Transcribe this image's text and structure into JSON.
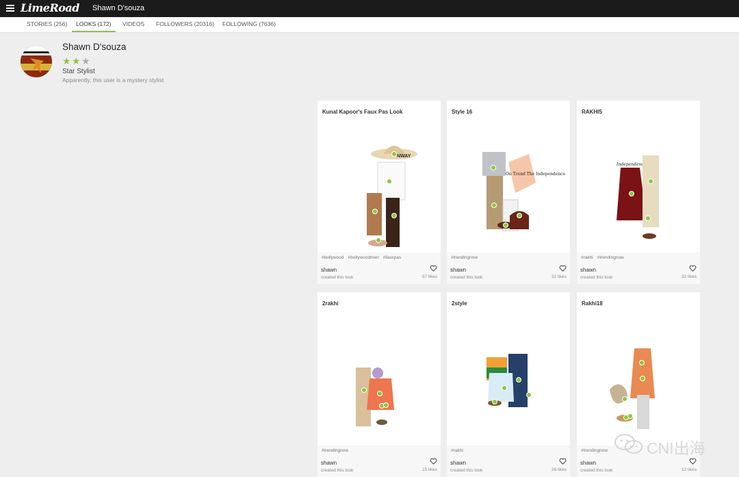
{
  "header": {
    "logo": "LimeRoad",
    "username": "Shawn D'souza"
  },
  "tabs": [
    {
      "label": "STORIES (256)"
    },
    {
      "label": "LOOKS (172)"
    },
    {
      "label": "VIDEOS"
    },
    {
      "label": "FOLLOWERS (20316)"
    },
    {
      "label": "FOLLOWING (7636)"
    }
  ],
  "profile": {
    "name": "Shawn D'souza",
    "rating": {
      "filled": 2,
      "max": 3
    },
    "rank": "Star Stylist",
    "bio": "Apparently, this user is a mystery stylist"
  },
  "cards": [
    {
      "title": "Kunal Kapoor's Faux Pas Look",
      "tags": [
        "#bollywood",
        "#bollywoodmen",
        "#fauxpas"
      ],
      "author": "shawn",
      "created": "created this look",
      "likes": "57 likes",
      "banner": "NWAY"
    },
    {
      "title": "Style 16",
      "tags": [
        "#trendingnow"
      ],
      "author": "shawn",
      "created": "created this look",
      "likes": "32 likes",
      "banner": "On Trend The Independence"
    },
    {
      "title": "RAKHI5",
      "tags": [
        "#rakhi",
        "#trendingnow"
      ],
      "author": "shawn",
      "created": "created this look",
      "likes": "32 likes",
      "banner": "Independence"
    },
    {
      "title": "2rakhi",
      "tags": [
        "#trendingnow"
      ],
      "author": "shawn",
      "created": "created this look",
      "likes": "15 likes"
    },
    {
      "title": "2style",
      "tags": [
        "#rakhi"
      ],
      "author": "shawn",
      "created": "created this look",
      "likes": "26 likes"
    },
    {
      "title": "Rakhi18",
      "tags": [
        "#trendingnow"
      ],
      "author": "shawn",
      "created": "created this look",
      "likes": "12 likes"
    }
  ],
  "watermark": {
    "text": "CNI出海"
  },
  "colors": {
    "accent": "#8cc63f",
    "topbar": "#1b1b1b",
    "page_bg": "#eeeeee"
  }
}
